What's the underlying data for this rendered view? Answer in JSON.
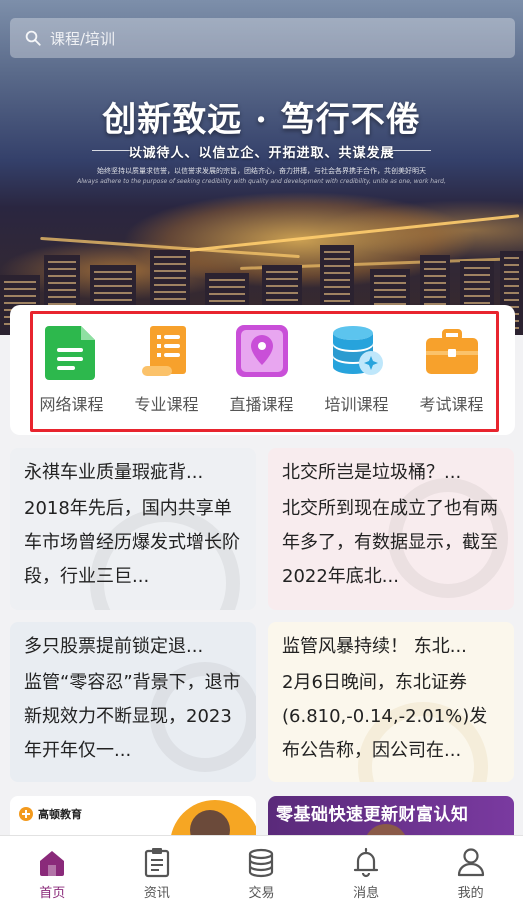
{
  "search": {
    "placeholder": "课程/培训"
  },
  "banner": {
    "title": "创新致远 · 笃行不倦",
    "subtitle": "以诚待人、以信立企、开拓进取、共谋发展",
    "tagline_cn": "始终坚持以质量求信誉，以信誉求发展的宗旨，团结齐心，奋力拼搏，与社会各界携手合作，共创美好明天",
    "tagline_en": "Always adhere to the purpose of seeking credibility with quality and development with credibility, unite as one, work hard,"
  },
  "categories": [
    {
      "label": "网络课程",
      "icon": "document-icon",
      "color": "#2db84d"
    },
    {
      "label": "专业课程",
      "icon": "scroll-icon",
      "color": "#f7a12c"
    },
    {
      "label": "直播课程",
      "icon": "location-pin-icon",
      "color": "#c94fd8"
    },
    {
      "label": "培训课程",
      "icon": "database-icon",
      "color": "#27a3dc"
    },
    {
      "label": "考试课程",
      "icon": "briefcase-icon",
      "color": "#f7a12c"
    }
  ],
  "news": [
    {
      "title": "永祺车业质量瑕疵背...",
      "body": "2018年先后，国内共享单车市场曾经历爆发式增长阶段，行业三巨..."
    },
    {
      "title": "北交所岂是垃圾桶？...",
      "body": "北交所到现在成立了也有两年多了，有数据显示，截至2022年底北..."
    },
    {
      "title": "多只股票提前锁定退...",
      "body": "监管“零容忍”背景下，退市新规效力不断显现，2023年开年仅一..."
    },
    {
      "title": "监管风暴持续！ 东北...",
      "body": "2月6日晚间，东北证券(6.810,-0.14,-2.01%)发布公告称，因公司在..."
    }
  ],
  "promos": [
    {
      "brand": "高顿教育"
    },
    {
      "title": "零基础快速更新财富认知"
    }
  ],
  "nav": [
    {
      "label": "首页",
      "icon": "home-icon",
      "active": true
    },
    {
      "label": "资讯",
      "icon": "clipboard-icon",
      "active": false
    },
    {
      "label": "交易",
      "icon": "coins-icon",
      "active": false
    },
    {
      "label": "消息",
      "icon": "bell-icon",
      "active": false
    },
    {
      "label": "我的",
      "icon": "user-icon",
      "active": false
    }
  ],
  "colors": {
    "accent": "#8a2a7a",
    "highlight_border": "#e8242e"
  }
}
